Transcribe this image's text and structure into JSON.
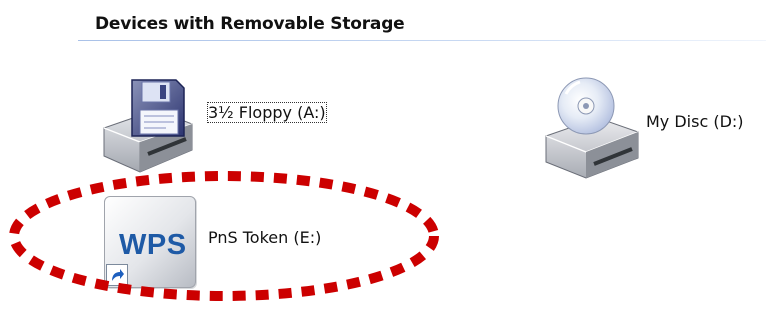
{
  "group": {
    "title": "Devices with Removable Storage",
    "rule_color": "#a9c1e8"
  },
  "drives": [
    {
      "label": "3½ Floppy (A:)",
      "icon": "floppy-drive-icon",
      "focused": true
    },
    {
      "label": "My Disc (D:)",
      "icon": "cd-drive-icon"
    },
    {
      "label": "PnS Token (E:)",
      "icon": "wps-shortcut-icon",
      "icon_text": "WPS"
    }
  ],
  "annotation": {
    "shape": "dashed-ellipse",
    "color": "#cc0000"
  }
}
